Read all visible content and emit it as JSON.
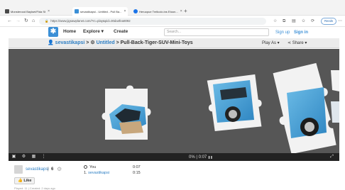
{
  "browser": {
    "tabs": [
      {
        "label": "Monsterood Baylset/Fida St",
        "active": false,
        "icon_color": "#4a4a4a"
      },
      {
        "label": "sevastikapsi - Untitled - Pull Ba...",
        "active": true,
        "icon_color": "#3b8fd6"
      },
      {
        "label": "Heruopue Trellcolo.ins Etoon...",
        "active": false,
        "icon_color": "#1a73e8"
      }
    ],
    "new_tab_glyph": "+",
    "url": "https://www.jigsawplanet.com/?rc=play&pid=30da4fea8092",
    "profile_label": "Reeds",
    "icons": [
      "back-icon",
      "forward-icon",
      "reload-icon",
      "home-icon",
      "star-icon",
      "extensions-icon",
      "menu-icon"
    ]
  },
  "site": {
    "logo_glyph": "✱",
    "nav": {
      "home": "Home",
      "explore": "Explore ▾",
      "create": "Create"
    },
    "search_placeholder": "Search...",
    "signup": "Sign up",
    "signin": "Sign in"
  },
  "titlebar": {
    "user": "sevastikapsi",
    "sep1": ">",
    "folder": "Untitled",
    "sep2": ">",
    "puzzle": "Pull-Back-Tiger-SUV-Mini-Toys",
    "play_as": "Play As ▾",
    "share": "Share ▾"
  },
  "controls": {
    "progress_text": "0% | 0:07",
    "pause_glyph": "❚❚"
  },
  "info": {
    "owner": "sevastikapsi",
    "owner_sep": "|",
    "score": "6",
    "you_label": "You",
    "you_time": "0:07",
    "rank_label": "1.",
    "rank_user": "sevastikapsi",
    "rank_time": "0:15",
    "like_label": "Like",
    "played_text": "Played: 11 | Created: 2 days ago"
  },
  "colors": {
    "accent": "#3b8fd6",
    "stage_bg": "#565656",
    "car_body": "#4aa3d8"
  }
}
